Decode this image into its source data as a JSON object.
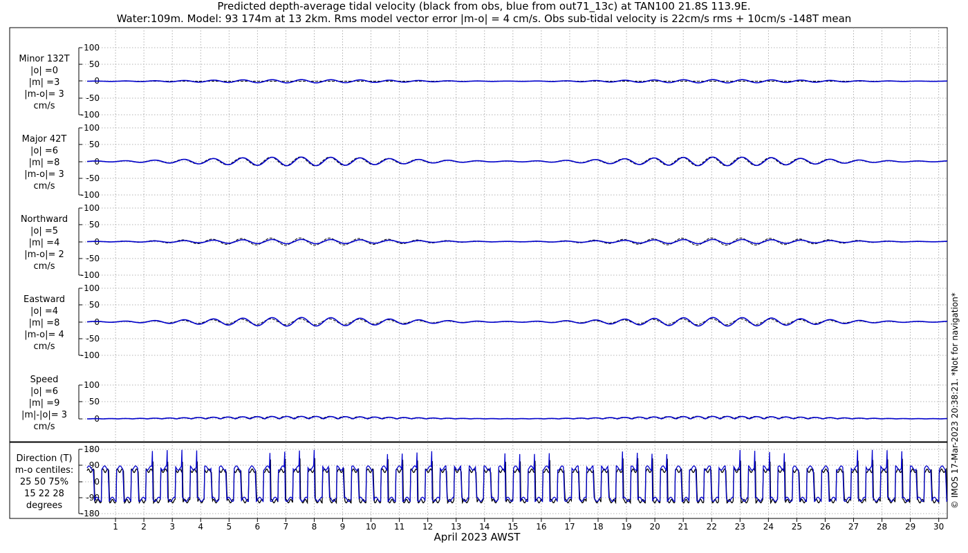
{
  "title_line1": "Predicted depth-average tidal velocity (black from obs, blue from out71_13c) at TAN100 21.8S 113.9E.",
  "title_line2": "Water:109m. Model: 93 174m at 13 2km. Rms model vector error |m-o| = 4 cm/s. Obs sub-tidal velocity is 22cm/s rms + 10cm/s -148T mean",
  "credit": "© IMOS 17-Mar-2023 20:38:21. *Not for navigation*",
  "colors": {
    "obs": "#000000",
    "model": "#0000cc"
  },
  "chart_data": {
    "type": "line",
    "xlabel": "April 2023 AWST",
    "x_ticks": [
      "1",
      "2",
      "3",
      "4",
      "5",
      "6",
      "7",
      "8",
      "9",
      "10",
      "11",
      "12",
      "13",
      "14",
      "15",
      "16",
      "17",
      "18",
      "19",
      "20",
      "21",
      "22",
      "23",
      "24",
      "25",
      "26",
      "27",
      "28",
      "29",
      "30"
    ],
    "xlim": [
      0,
      30.3
    ],
    "series_legend": {
      "obs": "black from obs",
      "model": "blue from out71_13c"
    },
    "panels": [
      {
        "id": "minor",
        "label": [
          "Minor 132T",
          "|o| =0",
          "|m| =3",
          "|m-o|= 3",
          "cm/s"
        ],
        "ylim": [
          -100,
          100
        ],
        "yticks": [
          "100",
          "50",
          "0",
          "-50",
          "-100"
        ],
        "obs_amplitude": 0,
        "model_amplitude": 3
      },
      {
        "id": "major",
        "label": [
          "Major 42T",
          "|o| =6",
          "|m| =8",
          "|m-o|= 3",
          "cm/s"
        ],
        "ylim": [
          -100,
          100
        ],
        "yticks": [
          "100",
          "50",
          "0",
          "-50",
          "-100"
        ],
        "obs_amplitude": 6,
        "model_amplitude": 8
      },
      {
        "id": "north",
        "label": [
          "Northward",
          "|o| =5",
          "|m| =4",
          "|m-o|= 2",
          "cm/s"
        ],
        "ylim": [
          -100,
          100
        ],
        "yticks": [
          "100",
          "50",
          "0",
          "-50",
          "-100"
        ],
        "obs_amplitude": 5,
        "model_amplitude": 4
      },
      {
        "id": "east",
        "label": [
          "Eastward",
          "|o| =4",
          "|m| =8",
          "|m-o|= 4",
          "cm/s"
        ],
        "ylim": [
          -100,
          100
        ],
        "yticks": [
          "100",
          "50",
          "0",
          "-50",
          "-100"
        ],
        "obs_amplitude": 4,
        "model_amplitude": 8
      },
      {
        "id": "speed",
        "label": [
          "Speed",
          "|o| =6",
          "|m| =9",
          "|m|-|o|= 3",
          "cm/s"
        ],
        "ylim": [
          0,
          100
        ],
        "yticks": [
          "100",
          "50",
          "0"
        ],
        "obs_amplitude": 6,
        "model_amplitude": 9
      },
      {
        "id": "dir",
        "label": [
          "Direction (T)",
          "m-o centiles:",
          "25  50  75%",
          "15  22  28",
          "degrees"
        ],
        "ylim": [
          -180,
          180
        ],
        "yticks": [
          "180",
          "90",
          "0",
          "-90",
          "-180"
        ]
      }
    ]
  }
}
